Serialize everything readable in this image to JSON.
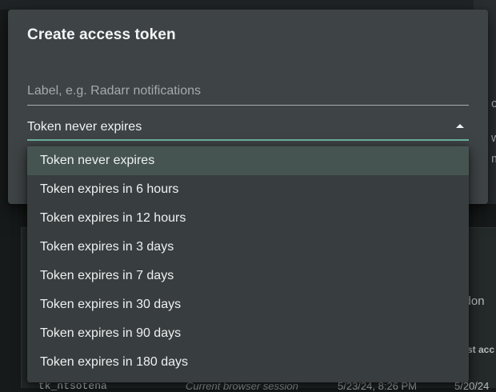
{
  "background": {
    "right_fragments": [
      "c",
      "w",
      "m"
    ],
    "card_fragments": {
      "dont": "u don",
      "last_access": "st acc",
      "row_id": "tk_ntsotena",
      "row_session": "Current browser session",
      "row_created": "5/23/24, 8:26 PM",
      "row_last": "5/20/24"
    }
  },
  "dialog": {
    "title": "Create access token",
    "label_input": {
      "placeholder": "Label, e.g. Radarr notifications",
      "value": ""
    },
    "expiry_select": {
      "value": "Token never expires"
    }
  },
  "dropdown": {
    "options": [
      {
        "label": "Token never expires",
        "selected": true
      },
      {
        "label": "Token expires in 6 hours",
        "selected": false
      },
      {
        "label": "Token expires in 12 hours",
        "selected": false
      },
      {
        "label": "Token expires in 3 days",
        "selected": false
      },
      {
        "label": "Token expires in 7 days",
        "selected": false
      },
      {
        "label": "Token expires in 30 days",
        "selected": false
      },
      {
        "label": "Token expires in 90 days",
        "selected": false
      },
      {
        "label": "Token expires in 180 days",
        "selected": false
      }
    ]
  },
  "colors": {
    "dialog_bg": "#3e4345",
    "dropdown_bg": "#383d3f",
    "selected_option_bg": "#455450",
    "accent_underline": "#6eb39e"
  }
}
